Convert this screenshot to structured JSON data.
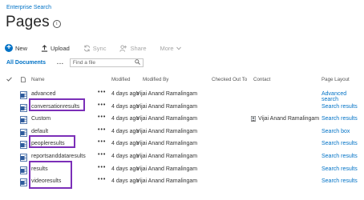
{
  "breadcrumb": "Enterprise Search",
  "page_title": "Pages",
  "toolbar": {
    "new_label": "New",
    "upload_label": "Upload",
    "sync_label": "Sync",
    "share_label": "Share",
    "more_label": "More"
  },
  "view": {
    "all_documents": "All Documents",
    "ellipsis": "...",
    "find_placeholder": "Find a file"
  },
  "columns": {
    "name": "Name",
    "modified": "Modified",
    "modified_by": "Modified By",
    "checked_out_to": "Checked Out To",
    "contact": "Contact",
    "page_layout": "Page Layout"
  },
  "rows": [
    {
      "name": "advanced",
      "modified": "4 days ago",
      "modified_by": "Vijai Anand Ramalingam",
      "contact": "",
      "layout": "Advanced search"
    },
    {
      "name": "conversationresults",
      "modified": "4 days ago",
      "modified_by": "Vijai Anand Ramalingam",
      "contact": "",
      "layout": "Search results"
    },
    {
      "name": "Custom",
      "modified": "4 days ago",
      "modified_by": "Vijai Anand Ramalingam",
      "contact": "Vijai Anand Ramalingam",
      "layout": "Search results"
    },
    {
      "name": "default",
      "modified": "4 days ago",
      "modified_by": "Vijai Anand Ramalingam",
      "contact": "",
      "layout": "Search box"
    },
    {
      "name": "peopleresults",
      "modified": "4 days ago",
      "modified_by": "Vijai Anand Ramalingam",
      "contact": "",
      "layout": "Search results"
    },
    {
      "name": "reportsanddataresults",
      "modified": "4 days ago",
      "modified_by": "Vijai Anand Ramalingam",
      "contact": "",
      "layout": "Search results"
    },
    {
      "name": "results",
      "modified": "4 days ago",
      "modified_by": "Vijai Anand Ramalingam",
      "contact": "",
      "layout": "Search results"
    },
    {
      "name": "videoresults",
      "modified": "4 days ago",
      "modified_by": "Vijai Anand Ramalingam",
      "contact": "",
      "layout": "Search results"
    }
  ],
  "colors": {
    "accent": "#0072c6",
    "highlight": "#7b2fb8"
  }
}
